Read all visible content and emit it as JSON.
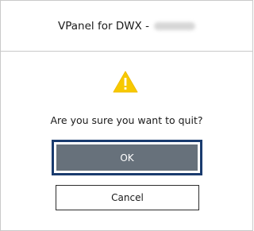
{
  "dialog": {
    "title": "VPanel for DWX -",
    "title_suffix_redacted": true,
    "message": "Are you sure you want to quit?",
    "icon": "warning-icon",
    "ok_label": "OK",
    "cancel_label": "Cancel"
  },
  "colors": {
    "warning_yellow": "#f7c900",
    "ok_fill": "#67717b",
    "ok_focus_border": "#1a3b6e",
    "border": "#c9c9c9"
  }
}
